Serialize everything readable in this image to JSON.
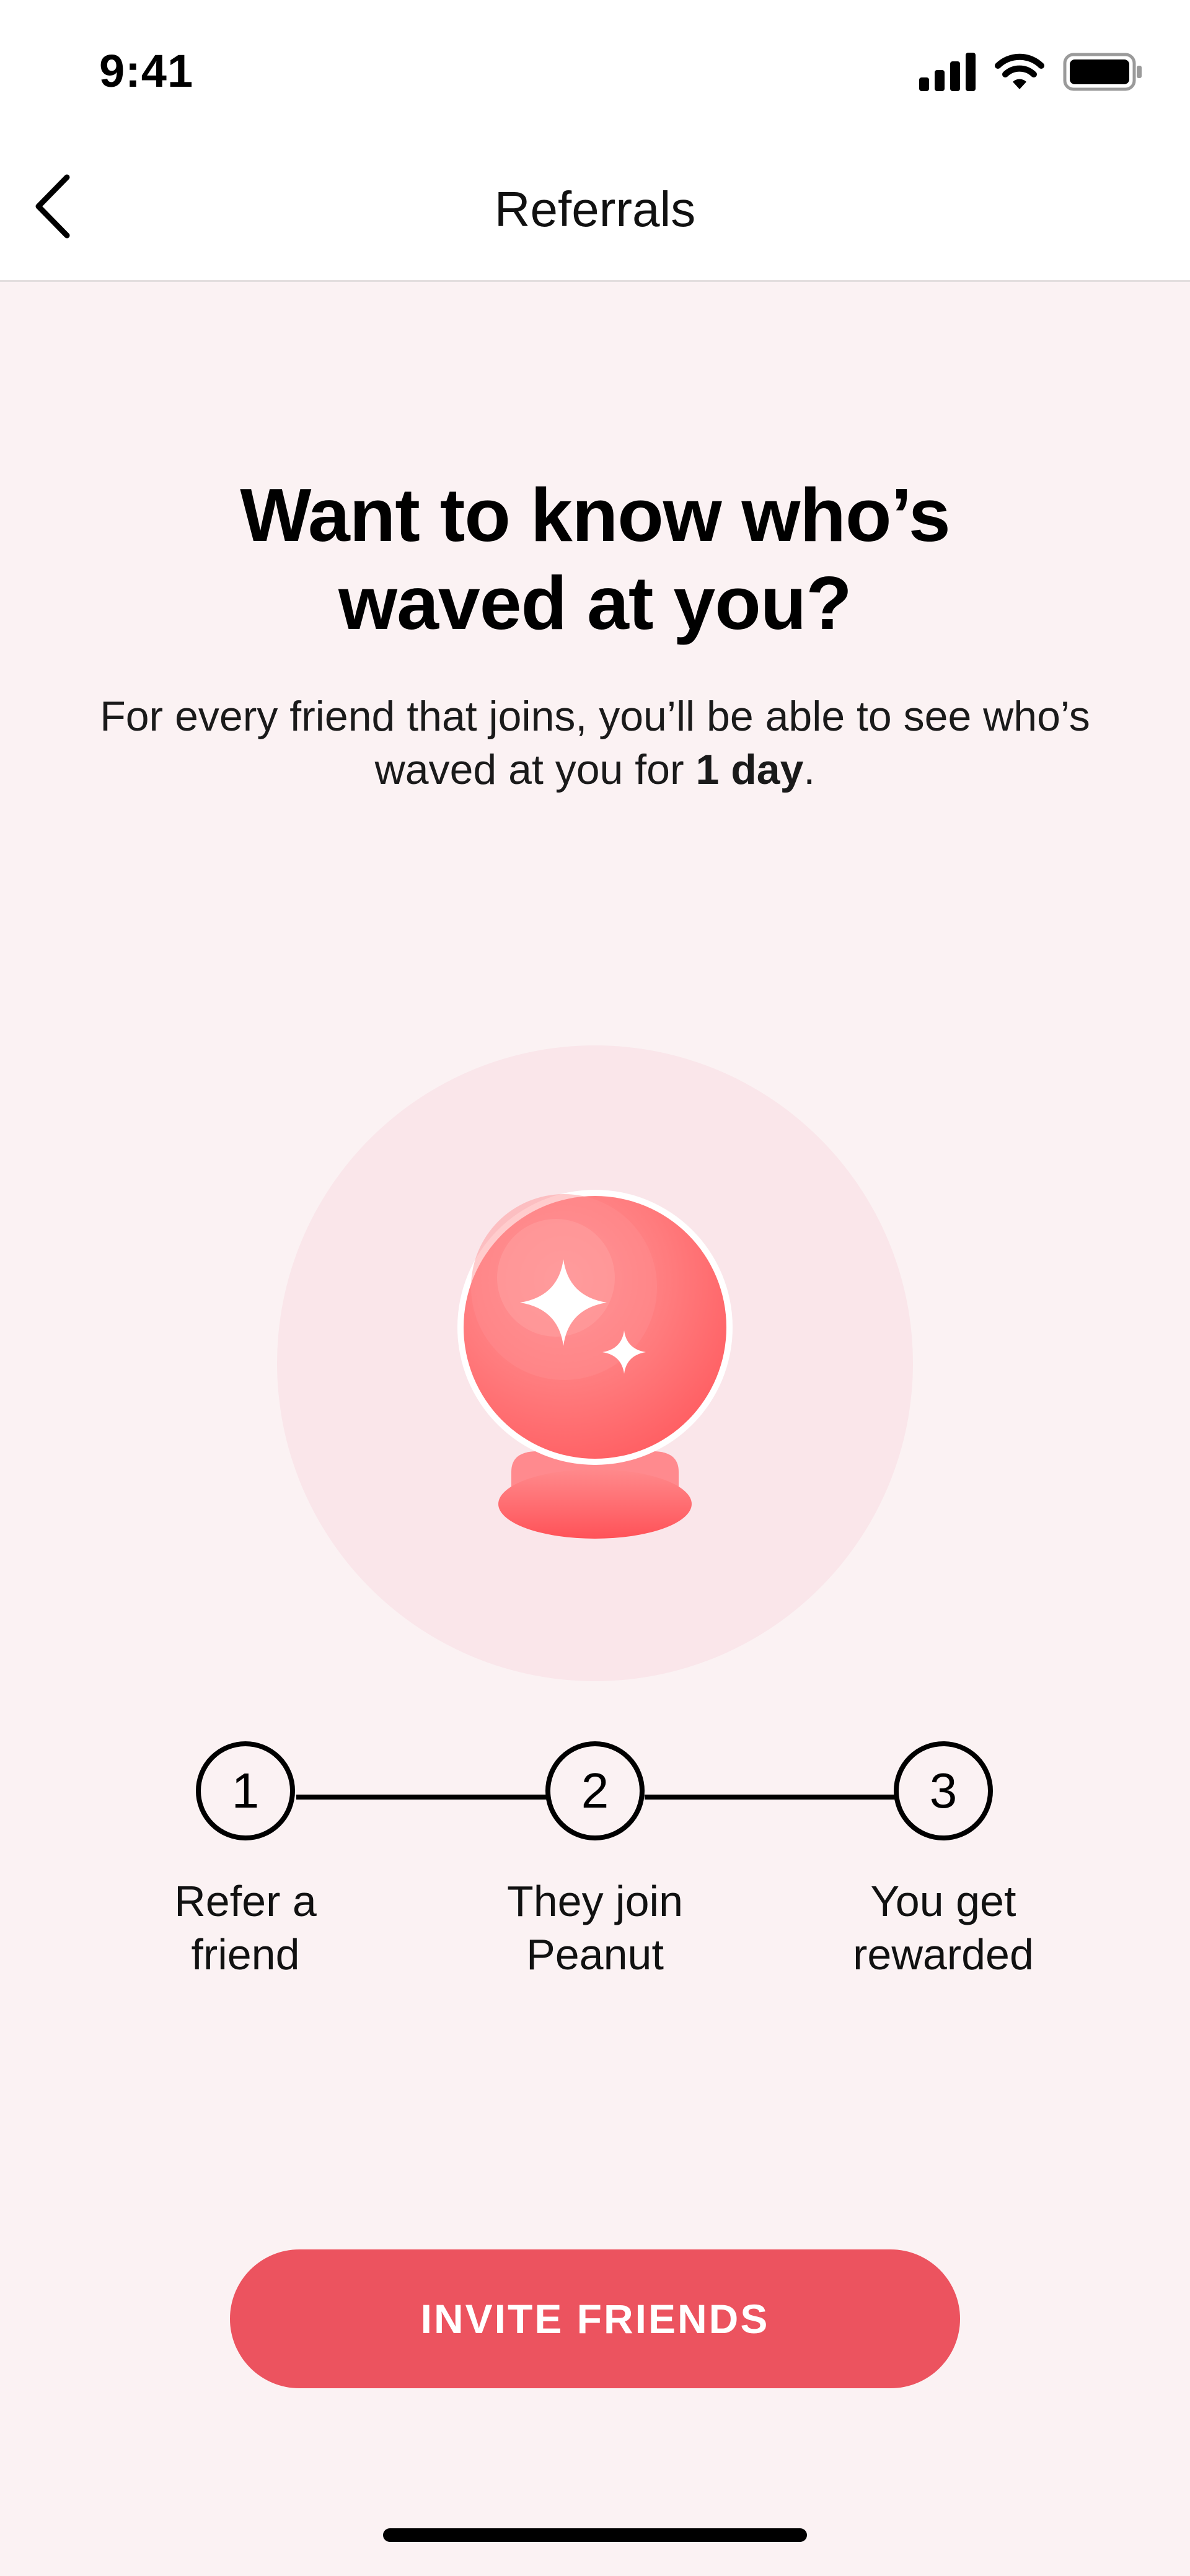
{
  "status_bar": {
    "time": "9:41",
    "icons": [
      "cellular-signal-icon",
      "wifi-icon",
      "battery-icon"
    ]
  },
  "header": {
    "title": "Referrals",
    "back_icon": "chevron-left-icon"
  },
  "hero": {
    "headline": "Want to know who’s waved at you?",
    "subtext_prefix": "For every friend that joins, you’ll be able to see who’s waved at you for ",
    "subtext_bold": "1 day",
    "subtext_suffix": "."
  },
  "illustration": {
    "icon": "crystal-ball-icon"
  },
  "steps": [
    {
      "number": "1",
      "label": "Refer a friend"
    },
    {
      "number": "2",
      "label": "They join Peanut"
    },
    {
      "number": "3",
      "label": "You get rewarded"
    }
  ],
  "cta": {
    "label": "INVITE FRIENDS"
  },
  "colors": {
    "background": "#fbf2f3",
    "accent": "#ec535f",
    "ball": "#ff6b6b",
    "halo": "#fae6ea"
  }
}
